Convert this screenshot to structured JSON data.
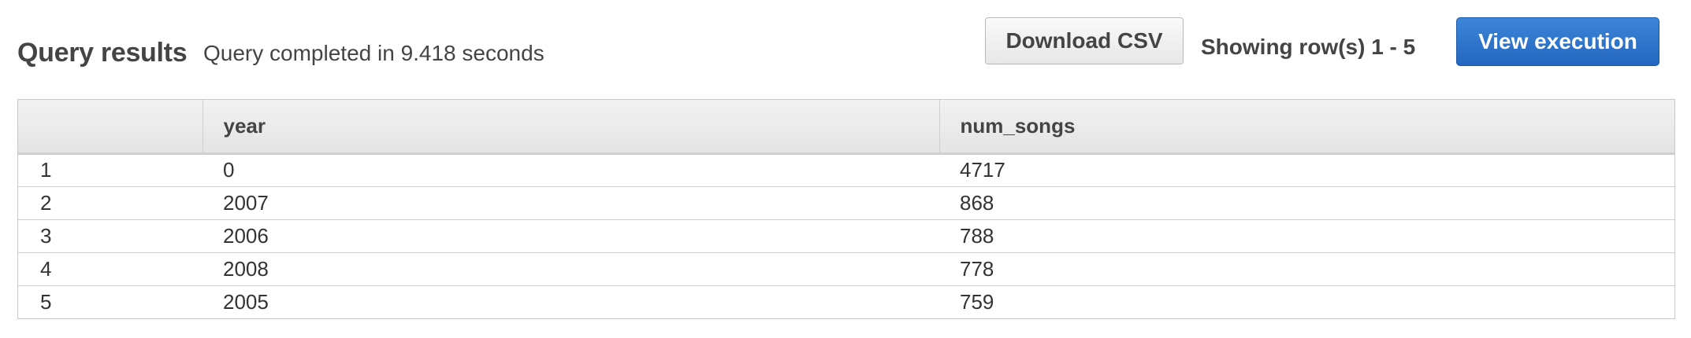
{
  "header": {
    "title": "Query results",
    "status": "Query completed in 9.418 seconds",
    "download_label": "Download CSV",
    "showing": "Showing row(s) 1 - 5",
    "view_label": "View execution"
  },
  "colors": {
    "primary_button": "#2d74cf",
    "text": "#444444",
    "border": "#c8c8c8"
  },
  "table": {
    "columns": [
      "",
      "year",
      "num_songs"
    ],
    "rows": [
      [
        "1",
        "0",
        "4717"
      ],
      [
        "2",
        "2007",
        "868"
      ],
      [
        "3",
        "2006",
        "788"
      ],
      [
        "4",
        "2008",
        "778"
      ],
      [
        "5",
        "2005",
        "759"
      ]
    ]
  }
}
